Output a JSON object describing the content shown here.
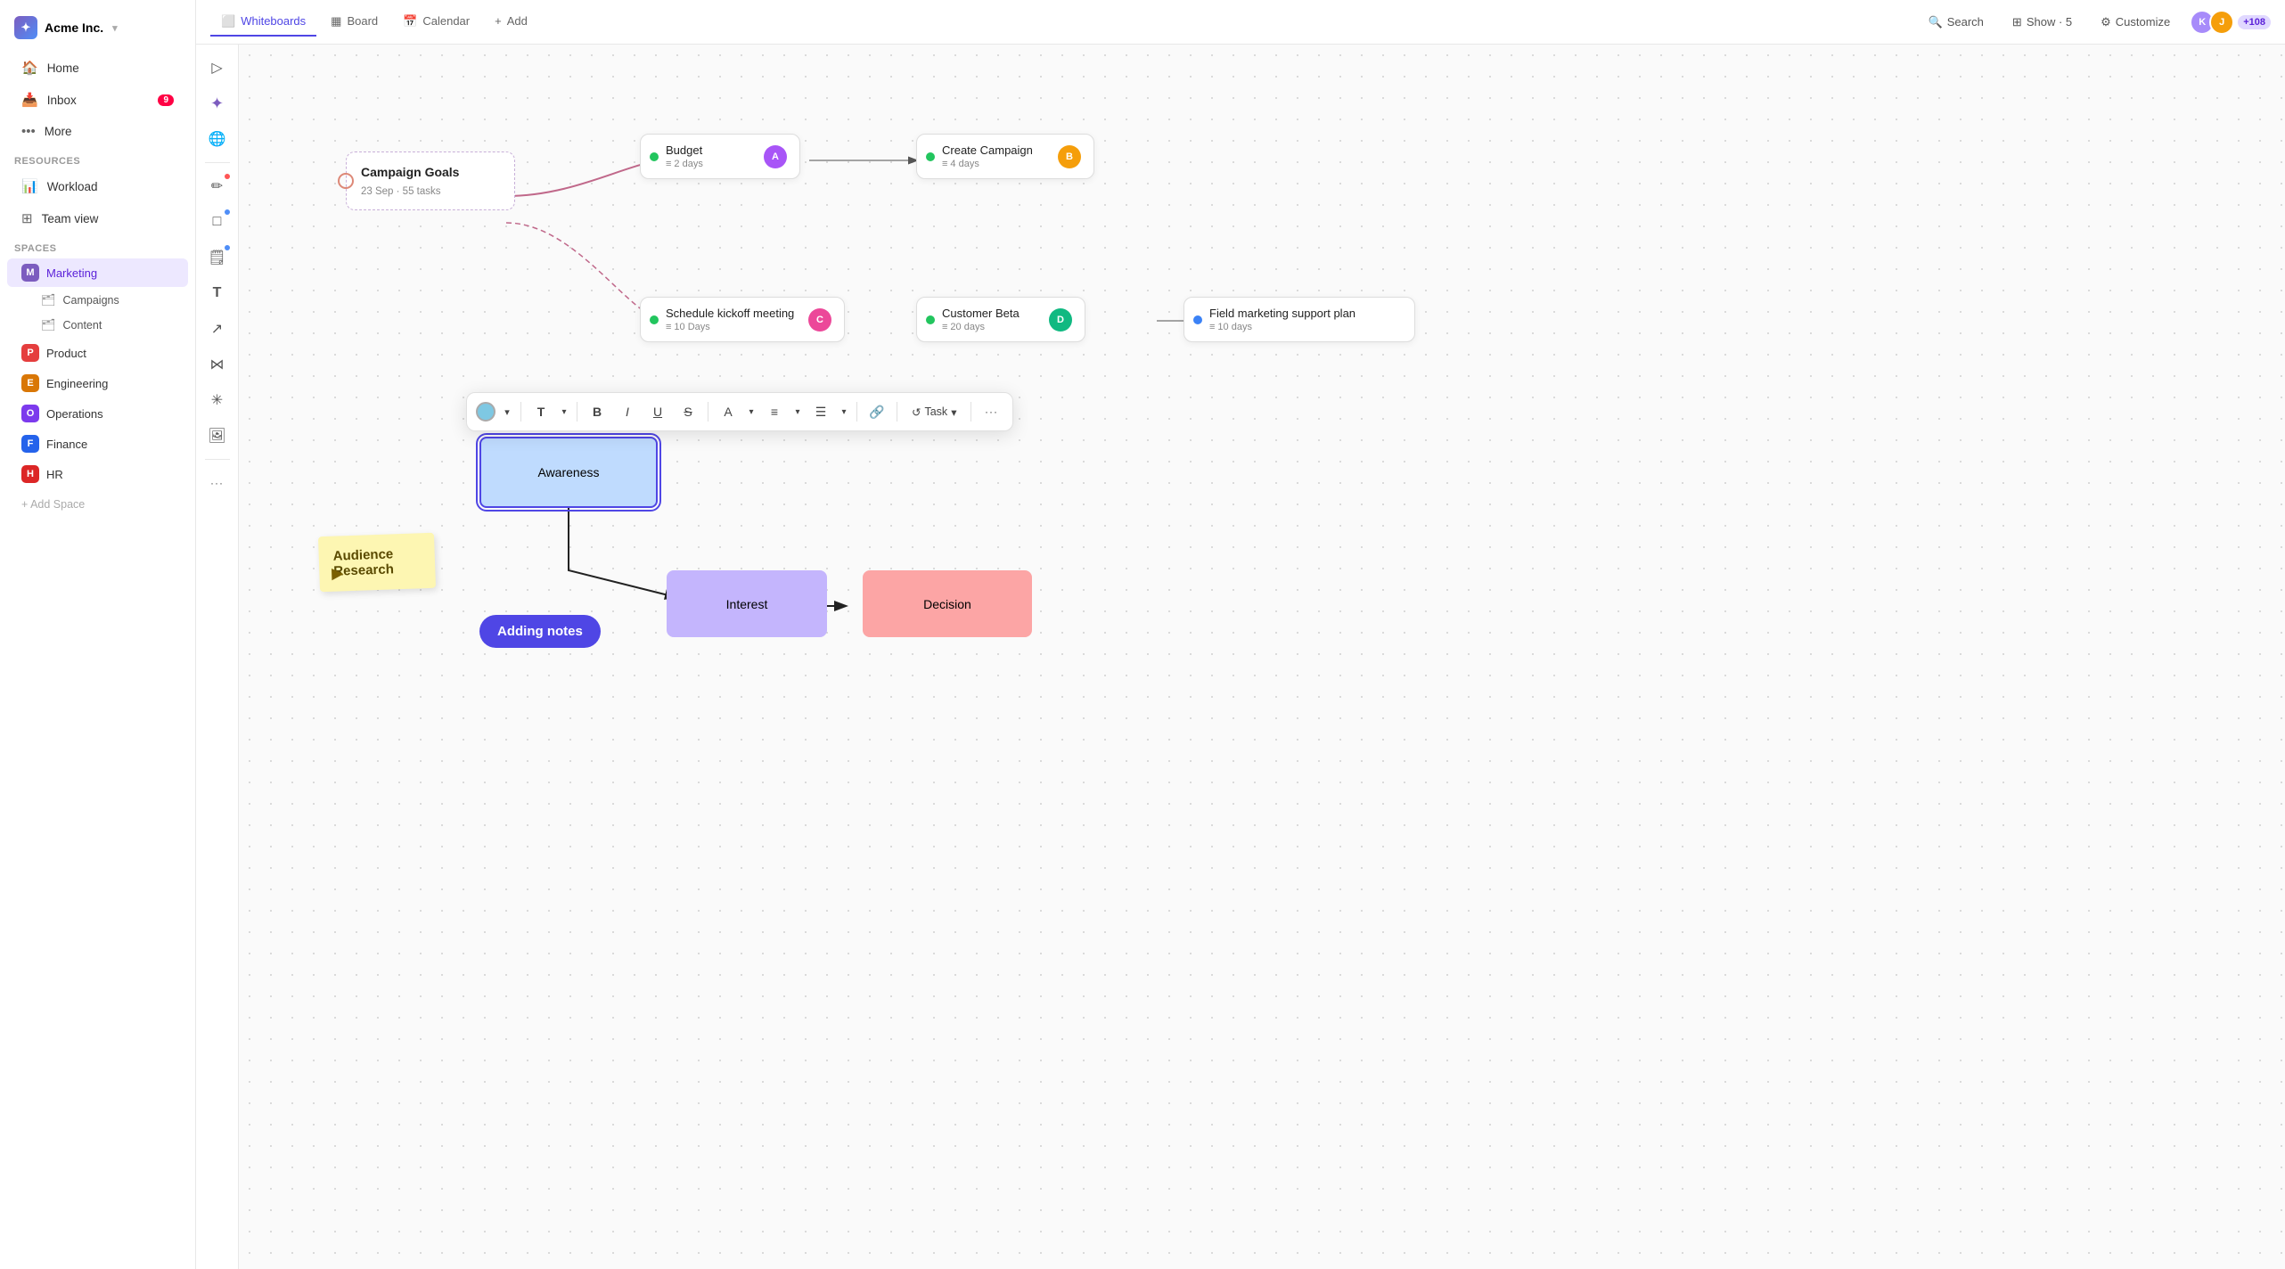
{
  "app": {
    "name": "Acme Inc.",
    "logo_letter": "✦"
  },
  "sidebar": {
    "nav": [
      {
        "id": "home",
        "label": "Home",
        "icon": "🏠"
      },
      {
        "id": "inbox",
        "label": "Inbox",
        "icon": "📥",
        "badge": "9"
      },
      {
        "id": "more",
        "label": "More",
        "icon": "••"
      }
    ],
    "resources_label": "Resources",
    "resources": [
      {
        "id": "workload",
        "label": "Workload",
        "icon": "📊"
      },
      {
        "id": "team-view",
        "label": "Team view",
        "icon": "⊞"
      }
    ],
    "spaces_label": "Spaces",
    "spaces": [
      {
        "id": "marketing",
        "label": "Marketing",
        "letter": "M",
        "color": "#7c5cbf",
        "active": true
      },
      {
        "id": "product",
        "label": "Product",
        "letter": "P",
        "color": "#e53e3e"
      },
      {
        "id": "engineering",
        "label": "Engineering",
        "letter": "E",
        "color": "#d97706"
      },
      {
        "id": "operations",
        "label": "Operations",
        "letter": "O",
        "color": "#7c3aed"
      },
      {
        "id": "finance",
        "label": "Finance",
        "letter": "F",
        "color": "#2563eb"
      },
      {
        "id": "hr",
        "label": "HR",
        "letter": "H",
        "color": "#dc2626"
      }
    ],
    "sub_items": [
      {
        "label": "Campaigns"
      },
      {
        "label": "Content"
      }
    ],
    "add_space": "+ Add Space"
  },
  "topbar": {
    "tabs": [
      {
        "id": "whiteboards",
        "label": "Whiteboards",
        "icon": "⬜",
        "active": true
      },
      {
        "id": "board",
        "label": "Board",
        "icon": "▦"
      },
      {
        "id": "calendar",
        "label": "Calendar",
        "icon": "📅"
      },
      {
        "id": "add",
        "label": "Add",
        "icon": "+"
      }
    ],
    "search": "Search",
    "show": "Show · 5",
    "customize": "Customize",
    "avatar_count": "+108"
  },
  "toolbar": {
    "tools": [
      {
        "id": "select",
        "icon": "▷",
        "dot": null
      },
      {
        "id": "ai",
        "icon": "✦",
        "dot": null
      },
      {
        "id": "globe",
        "icon": "🌐",
        "dot": null
      },
      {
        "id": "pen",
        "icon": "✏",
        "dot": "red"
      },
      {
        "id": "shape",
        "icon": "□",
        "dot": "blue"
      },
      {
        "id": "sticky",
        "icon": "🗒",
        "dot": "blue"
      },
      {
        "id": "text",
        "icon": "T",
        "dot": null
      },
      {
        "id": "arrow",
        "icon": "↗",
        "dot": null
      },
      {
        "id": "connect",
        "icon": "⋈",
        "dot": null
      },
      {
        "id": "effects",
        "icon": "✳",
        "dot": null
      },
      {
        "id": "image",
        "icon": "🖼",
        "dot": null
      },
      {
        "id": "more",
        "icon": "···",
        "dot": null
      }
    ]
  },
  "canvas": {
    "goals_card": {
      "title": "Campaign Goals",
      "meta": "23 Sep · 55 tasks"
    },
    "tasks": [
      {
        "id": "budget",
        "title": "Budget",
        "days": "2 days",
        "color": "#22c55e",
        "avatar_color": "#a855f7",
        "avatar_letter": "A"
      },
      {
        "id": "create-campaign",
        "title": "Create Campaign",
        "days": "4 days",
        "color": "#22c55e",
        "avatar_color": "#f59e0b",
        "avatar_letter": "B"
      },
      {
        "id": "schedule",
        "title": "Schedule kickoff meeting",
        "days": "10 Days",
        "color": "#22c55e",
        "avatar_color": "#ec4899",
        "avatar_letter": "C"
      },
      {
        "id": "customer-beta",
        "title": "Customer Beta",
        "days": "20 days",
        "color": "#22c55e",
        "avatar_color": "#10b981",
        "avatar_letter": "D"
      },
      {
        "id": "field-marketing",
        "title": "Field marketing support plan",
        "days": "10 days",
        "color": "#3b82f6",
        "avatar_color": null,
        "avatar_letter": null
      }
    ],
    "shapes": [
      {
        "id": "awareness",
        "label": "Awareness",
        "bg": "#bfdbfe",
        "border": "#4f46e5",
        "selected": true
      },
      {
        "id": "interest",
        "label": "Interest",
        "bg": "#c4b5fd",
        "border": "#c4b5fd"
      },
      {
        "id": "decision",
        "label": "Decision",
        "bg": "#fca5a5",
        "border": "#fca5a5"
      }
    ],
    "sticky": {
      "text": "Audience Research"
    },
    "adding_notes": "Adding notes"
  },
  "float_toolbar": {
    "color": "#7ec8e3",
    "buttons": [
      "T▾",
      "B",
      "I",
      "U",
      "S",
      "A▾",
      "≡▾",
      "☰▾",
      "🔗",
      "↺ Task▾",
      "···"
    ]
  }
}
